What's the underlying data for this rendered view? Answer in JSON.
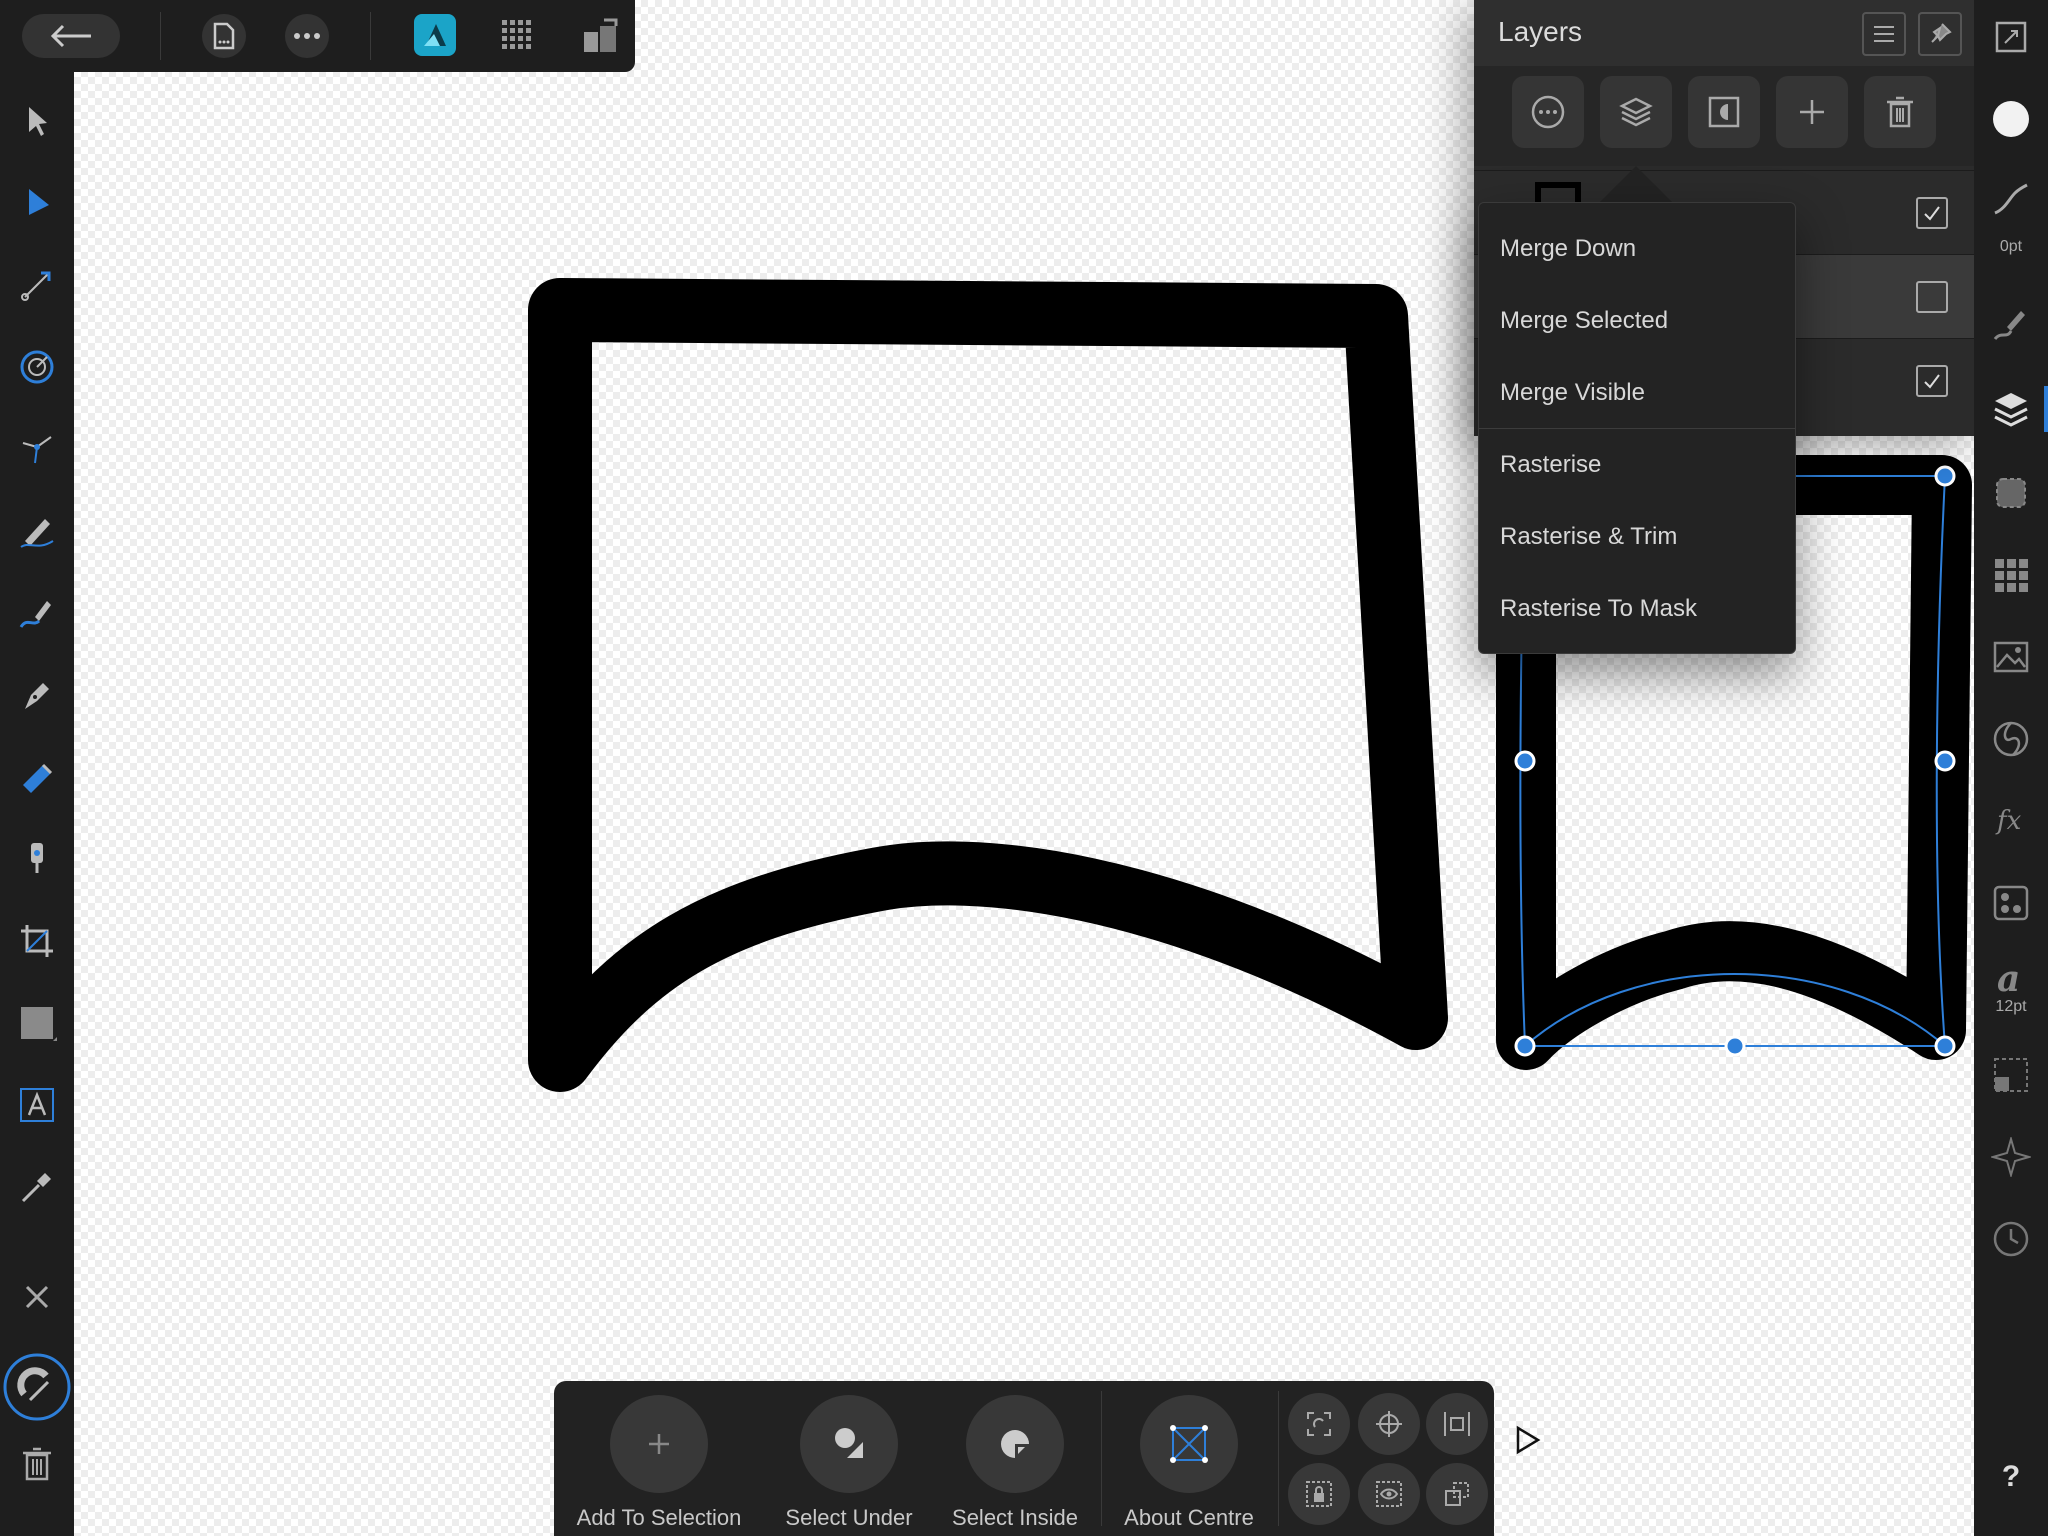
{
  "layers_panel": {
    "title": "Layers",
    "layers": [
      {
        "visible": true
      },
      {
        "visible": false
      },
      {
        "visible": true
      }
    ]
  },
  "merge_menu": {
    "items": [
      "Merge Down",
      "Merge Selected",
      "Merge Visible",
      "Rasterise",
      "Rasterise & Trim",
      "Rasterise To Mask"
    ]
  },
  "context_toolbar": {
    "add_to_selection": "Add To Selection",
    "select_under": "Select Under",
    "select_inside": "Select Inside",
    "about_centre": "About Centre"
  },
  "right_bar": {
    "stroke_width": "0pt",
    "font_size": "12pt",
    "help": "?"
  },
  "colors": {
    "accent": "#2e7fd9",
    "toolbar_bg": "#1e1e1e",
    "menu_bg": "#232323"
  }
}
